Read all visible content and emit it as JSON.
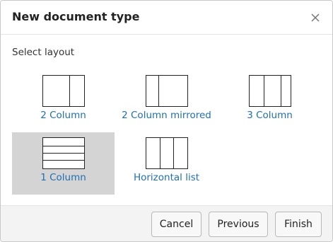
{
  "dialog": {
    "title": "New document type",
    "close_icon": "close-icon"
  },
  "body": {
    "section_label": "Select layout",
    "selected_layout": "1 Column",
    "layouts": [
      {
        "label": "2 Column",
        "icon": "two-column-layout-icon"
      },
      {
        "label": "2 Column mirrored",
        "icon": "two-column-mirrored-layout-icon"
      },
      {
        "label": "3 Column",
        "icon": "three-column-layout-icon"
      },
      {
        "label": "1 Column",
        "icon": "one-column-layout-icon"
      },
      {
        "label": "Horizontal list",
        "icon": "horizontal-list-layout-icon"
      }
    ]
  },
  "footer": {
    "cancel_label": "Cancel",
    "previous_label": "Previous",
    "finish_label": "Finish"
  },
  "colors": {
    "link": "#1f6fb2",
    "selected_bg": "#d4d4d4",
    "footer_bg": "#f3f3f3"
  }
}
